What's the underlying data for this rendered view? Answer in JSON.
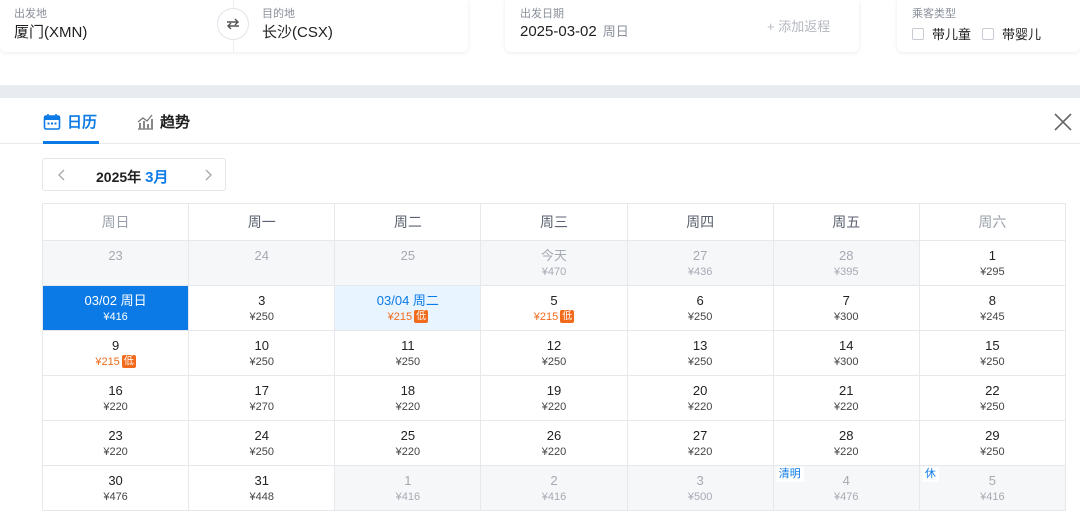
{
  "search": {
    "origin_label": "出发地",
    "origin_value": "厦门(XMN)",
    "dest_label": "目的地",
    "dest_value": "长沙(CSX)",
    "date_label": "出发日期",
    "date_value": "2025-03-02",
    "date_weekday": "周日",
    "add_return": "+ 添加返程",
    "pax_label": "乘客类型",
    "pax_options": [
      "带儿童",
      "带婴儿"
    ]
  },
  "tabs": {
    "calendar": "日历",
    "trend": "趋势"
  },
  "month_selector": {
    "year": "2025年",
    "month": "3月"
  },
  "weekdays": [
    "周日",
    "周一",
    "周二",
    "周三",
    "周四",
    "周五",
    "周六"
  ],
  "weeks": [
    [
      {
        "day": "23",
        "price": "",
        "state": "past"
      },
      {
        "day": "24",
        "price": "",
        "state": "past"
      },
      {
        "day": "25",
        "price": "",
        "state": "past"
      },
      {
        "day": "今天",
        "price": "¥470",
        "state": "past"
      },
      {
        "day": "27",
        "price": "¥436",
        "state": "past"
      },
      {
        "day": "28",
        "price": "¥395",
        "state": "past"
      },
      {
        "day": "1",
        "price": "¥295",
        "state": "normal"
      }
    ],
    [
      {
        "day": "03/02 周日",
        "price": "¥416",
        "state": "selected"
      },
      {
        "day": "3",
        "price": "¥250",
        "state": "normal"
      },
      {
        "day": "03/04 周二",
        "price": "¥215",
        "state": "highlight",
        "low": "低"
      },
      {
        "day": "5",
        "price": "¥215",
        "state": "normal",
        "low": "低"
      },
      {
        "day": "6",
        "price": "¥250",
        "state": "normal"
      },
      {
        "day": "7",
        "price": "¥300",
        "state": "normal"
      },
      {
        "day": "8",
        "price": "¥245",
        "state": "normal"
      }
    ],
    [
      {
        "day": "9",
        "price": "¥215",
        "state": "normal",
        "low": "低"
      },
      {
        "day": "10",
        "price": "¥250",
        "state": "normal"
      },
      {
        "day": "11",
        "price": "¥250",
        "state": "normal"
      },
      {
        "day": "12",
        "price": "¥250",
        "state": "normal"
      },
      {
        "day": "13",
        "price": "¥250",
        "state": "normal"
      },
      {
        "day": "14",
        "price": "¥300",
        "state": "normal"
      },
      {
        "day": "15",
        "price": "¥250",
        "state": "normal"
      }
    ],
    [
      {
        "day": "16",
        "price": "¥220",
        "state": "normal"
      },
      {
        "day": "17",
        "price": "¥270",
        "state": "normal"
      },
      {
        "day": "18",
        "price": "¥220",
        "state": "normal"
      },
      {
        "day": "19",
        "price": "¥220",
        "state": "normal"
      },
      {
        "day": "20",
        "price": "¥220",
        "state": "normal"
      },
      {
        "day": "21",
        "price": "¥220",
        "state": "normal"
      },
      {
        "day": "22",
        "price": "¥250",
        "state": "normal"
      }
    ],
    [
      {
        "day": "23",
        "price": "¥220",
        "state": "normal"
      },
      {
        "day": "24",
        "price": "¥250",
        "state": "normal"
      },
      {
        "day": "25",
        "price": "¥220",
        "state": "normal"
      },
      {
        "day": "26",
        "price": "¥220",
        "state": "normal"
      },
      {
        "day": "27",
        "price": "¥220",
        "state": "normal"
      },
      {
        "day": "28",
        "price": "¥220",
        "state": "normal"
      },
      {
        "day": "29",
        "price": "¥250",
        "state": "normal"
      }
    ],
    [
      {
        "day": "30",
        "price": "¥476",
        "state": "normal"
      },
      {
        "day": "31",
        "price": "¥448",
        "state": "normal"
      },
      {
        "day": "1",
        "price": "¥416",
        "state": "other"
      },
      {
        "day": "2",
        "price": "¥416",
        "state": "other"
      },
      {
        "day": "3",
        "price": "¥500",
        "state": "other"
      },
      {
        "day": "4",
        "price": "¥476",
        "state": "other",
        "holiday": "清明"
      },
      {
        "day": "5",
        "price": "¥416",
        "state": "other",
        "holiday": "休"
      }
    ]
  ],
  "colors": {
    "accent": "#0b7ae6",
    "low_price": "#f26a1b",
    "highlight_bg": "#e8f4ff",
    "past_bg": "#f6f7f9"
  }
}
